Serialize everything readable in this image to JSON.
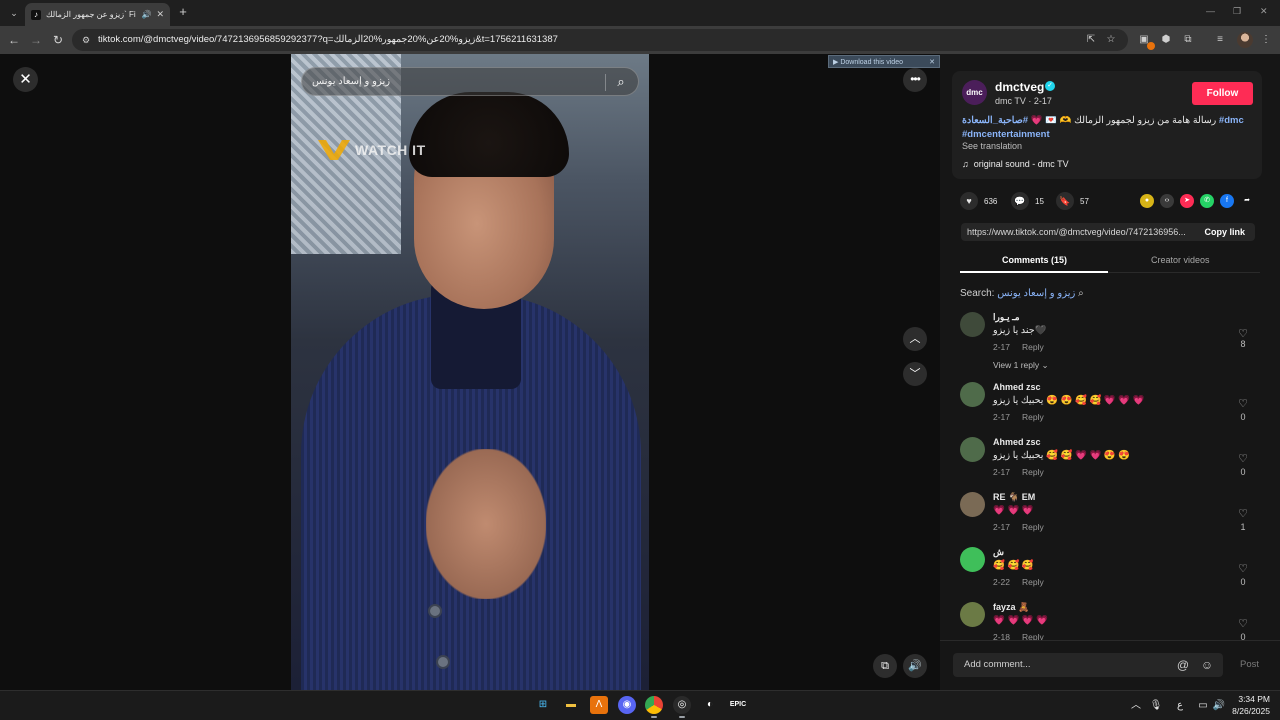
{
  "browser": {
    "tab_title": "زيزو عن جمهور الزمالك` Find",
    "url": "tiktok.com/@dmctveg/video/7472136956859292377?q=زيزو%20عن%20جمهور%20الزمالك&t=1756211631387"
  },
  "video": {
    "search_text": "زيزو و إسعاد يونس",
    "watermark": "WATCH IT",
    "download_bar_text": "▶ Download this video"
  },
  "post": {
    "channel_name": "dmctveg",
    "avatar_text": "dmc",
    "channel_sub": "dmc TV · 2-17",
    "follow_label": "Follow",
    "caption_text": "رسالة هامة من زيزو لجمهور الزمالك 🫶 💌 💗",
    "caption_tags": "#صاحبة_السعادة #dmc",
    "caption_tag2": "#dmcentertainment",
    "see_translation": "See translation",
    "sound": "original sound - dmc TV"
  },
  "stats": {
    "likes": "636",
    "comments": "15",
    "saves": "57"
  },
  "share": {
    "link": "https://www.tiktok.com/@dmctveg/video/7472136956...",
    "copy_label": "Copy link"
  },
  "tabs": {
    "comments_label": "Comments (15)",
    "creator_label": "Creator videos"
  },
  "search_prefix": "Search:",
  "search_query": "زيزو و إسعاد يونس",
  "comments": [
    {
      "name": "مـ يـورا",
      "text": "جند يا زيزو🖤",
      "date": "2-17",
      "reply": "Reply",
      "likes": "8",
      "view_replies": "View 1 reply ⌄",
      "avatar_color": "#3f4a3a"
    },
    {
      "name": "Ahmed zsc",
      "text": "يحبيك يا زيزو 😍 😍 🥰 🥰 💗 💗 💗",
      "date": "2-17",
      "reply": "Reply",
      "likes": "0",
      "avatar_color": "#4f6b4a"
    },
    {
      "name": "Ahmed zsc",
      "text": "يحبيك يا زيزو 🥰 🥰 💗 💗 😍 😍",
      "date": "2-17",
      "reply": "Reply",
      "likes": "0",
      "avatar_color": "#4f6b4a"
    },
    {
      "name": "RE 🐐 EM",
      "text": "💗 💗 💗",
      "date": "2-17",
      "reply": "Reply",
      "likes": "1",
      "avatar_color": "#7a6a55"
    },
    {
      "name": "ش",
      "text": "🥰 🥰 🥰",
      "date": "2-22",
      "reply": "Reply",
      "likes": "0",
      "avatar_color": "#3fbf5a"
    },
    {
      "name": "fayza 🧸",
      "text": "💗 💗 💗 💗",
      "date": "2-18",
      "reply": "Reply",
      "likes": "0",
      "avatar_color": "#6b7a45"
    }
  ],
  "add_comment": {
    "placeholder": "Add comment...",
    "post_label": "Post"
  },
  "taskbar": {
    "time": "3:34 PM",
    "date": "8/26/2025",
    "lang": "ع"
  },
  "colors": {
    "accent": "#fe2c55",
    "verified": "#20d5ec",
    "hashtag": "#8ab4f8"
  }
}
